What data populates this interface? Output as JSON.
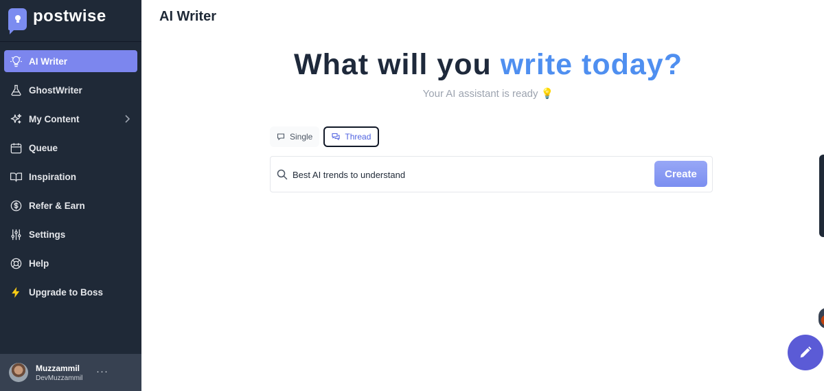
{
  "brand": {
    "name": "postwise"
  },
  "nav": {
    "items": [
      {
        "label": "AI Writer",
        "icon": "lightbulb-icon",
        "active": true
      },
      {
        "label": "GhostWriter",
        "icon": "flask-icon"
      },
      {
        "label": "My Content",
        "icon": "sparkles-icon",
        "has_chevron": true
      },
      {
        "label": "Queue",
        "icon": "calendar-icon"
      },
      {
        "label": "Inspiration",
        "icon": "book-open-icon"
      },
      {
        "label": "Refer & Earn",
        "icon": "dollar-circle-icon"
      },
      {
        "label": "Settings",
        "icon": "sliders-icon"
      },
      {
        "label": "Help",
        "icon": "lifebuoy-icon"
      },
      {
        "label": "Upgrade to Boss",
        "icon": "lightning-icon"
      }
    ]
  },
  "user": {
    "name": "Muzzammil",
    "handle": "DevMuzzammil",
    "more": "···"
  },
  "page": {
    "title": "AI Writer"
  },
  "hero": {
    "title_part1": "What will you",
    "title_part2": "write today?",
    "subtitle": "Your AI assistant is ready 💡"
  },
  "mode": {
    "options": [
      {
        "label": "Single",
        "icon": "chat-bubble-icon",
        "selected": false
      },
      {
        "label": "Thread",
        "icon": "chat-bubbles-icon",
        "selected": true
      }
    ]
  },
  "prompt": {
    "value": "Best AI trends to understand",
    "button_label": "Create"
  },
  "colors": {
    "sidebar": "#1f2937",
    "accent": "#7c86ee",
    "title_accent": "#4f8ff0",
    "fab": "#5b5bd6"
  }
}
